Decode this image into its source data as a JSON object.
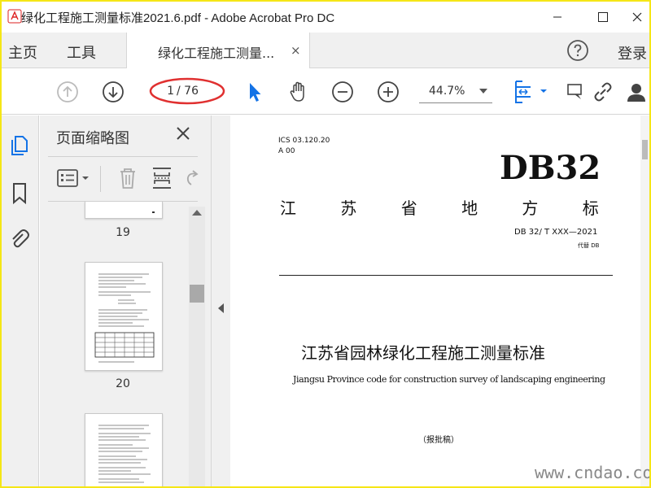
{
  "window": {
    "title": "绿化工程施工测量标准2021.6.pdf - Adobe Acrobat Pro DC",
    "icon": "acrobat-icon"
  },
  "menubar": {
    "home": "主页",
    "tools": "工具",
    "tab_label": "绿化工程施工测量...",
    "tab_close": "×",
    "sign_in": "登录"
  },
  "toolbar": {
    "page_current": "1",
    "page_total": "/ 76",
    "zoom": "44.7%",
    "accent": "#1473e6"
  },
  "thumbnails": {
    "title": "页面缩略图",
    "pages": [
      {
        "label": "19"
      },
      {
        "label": "20"
      }
    ]
  },
  "document": {
    "ics": "ICS 03.120.20",
    "a00": "A 00",
    "code": "DB32",
    "province_standard": "江 苏 省 地 方 标 准",
    "number": "DB 32/ T XXX—2021",
    "replaces": "代替 DB",
    "title_cn": "江苏省园林绿化工程施工测量标准",
    "title_en": "Jiangsu Province code for construction survey of landscaping engineering",
    "draft": "（报批稿）"
  },
  "watermark": "www.cndao.com",
  "annotation_color": "#e03030"
}
